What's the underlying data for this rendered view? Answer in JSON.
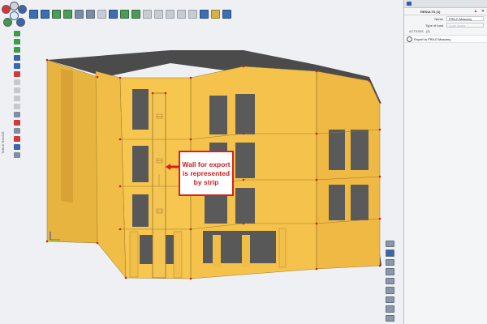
{
  "panel": {
    "app_title": "",
    "header": "RESULTS (1)",
    "fields": [
      {
        "label": "Name",
        "value": "FRILO Masonry",
        "disabled": false
      },
      {
        "label": "Type of load",
        "value": "Load cases",
        "disabled": true
      }
    ],
    "actions_label": "ACTIONS",
    "actions_count": "(3)",
    "action_item": "Export to FRILO Masonry"
  },
  "side_tab_label": "TABLE RANGE",
  "callout": {
    "line1": "Wall for export",
    "line2": "is represented",
    "line3": "by strip"
  },
  "colors": {
    "wall": "#f6c64e",
    "wall_shade": "#e3ac36",
    "slab": "#4a4a4a",
    "callout_border": "#d92020",
    "accent": "#2f5ea8"
  }
}
